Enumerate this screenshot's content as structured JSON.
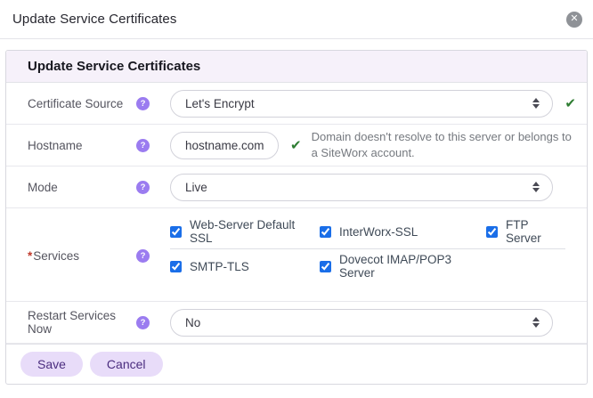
{
  "dialog": {
    "title": "Update Service Certificates"
  },
  "icons": {
    "close": "✕",
    "help": "?",
    "check": "✔"
  },
  "panel": {
    "header": "Update Service Certificates"
  },
  "form": {
    "certificate_source": {
      "label": "Certificate Source",
      "value": "Let's Encrypt"
    },
    "hostname": {
      "label": "Hostname",
      "value": "hostname.com",
      "hint": "Domain doesn't resolve to this server or belongs to a SiteWorx account."
    },
    "mode": {
      "label": "Mode",
      "value": "Live"
    },
    "services": {
      "required_marker": "*",
      "label": "Services",
      "options": [
        {
          "label": "Web-Server Default SSL",
          "checked": true
        },
        {
          "label": "InterWorx-SSL",
          "checked": true
        },
        {
          "label": "FTP Server",
          "checked": true
        },
        {
          "label": "SMTP-TLS",
          "checked": true
        },
        {
          "label": "Dovecot IMAP/POP3 Server",
          "checked": true
        }
      ]
    },
    "restart_services": {
      "label": "Restart Services Now",
      "value": "No"
    }
  },
  "footer": {
    "save_label": "Save",
    "cancel_label": "Cancel"
  },
  "colors": {
    "accent_purple": "#9b7cf0",
    "button_bg": "#e8dcf9",
    "button_text": "#4b2d7f",
    "checkbox_blue": "#1a6ee8",
    "success_green": "#2e7d32",
    "header_bg": "#f6f1fa"
  }
}
